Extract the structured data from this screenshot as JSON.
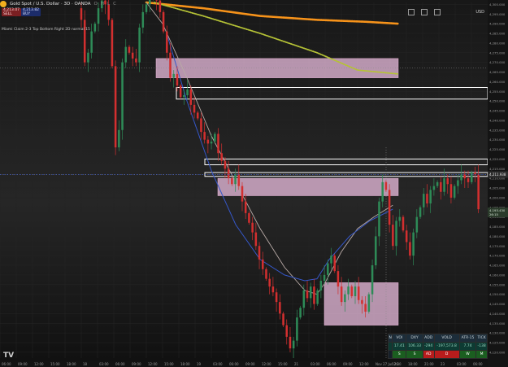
{
  "header": {
    "title": "Gold Spot / U.S. Dollar · 3D · OANDA",
    "ohlc": [
      "O",
      "H",
      "L",
      "C"
    ]
  },
  "quotes": {
    "sell": {
      "price": "4,213.07",
      "label": "SELL"
    },
    "buy": {
      "price": "4,213.82",
      "label": "BUY"
    }
  },
  "indicator_label": "Miami Claim 2-3 Top Bottom Right 2D normal 15",
  "currency": "USD",
  "colors": {
    "background": "#151515",
    "bull": "#2e8b57",
    "bear": "#d32f2f",
    "zone_pink": "#f3c4e6",
    "zone_white": "#ffffff",
    "ema_orange": "#f7931a",
    "ema_olive": "#b5c236",
    "ma_light": "#b8aaa6",
    "ma_blue": "#3557c8",
    "grid": "#242424"
  },
  "chart_data": {
    "type": "candlestick",
    "symbol": "Gold Spot / U.S. Dollar",
    "interval": "3D",
    "broker": "OANDA",
    "ylim": [
      4117,
      4301
    ],
    "ylabels": [
      "4,300.000",
      "4,295.000",
      "4,290.000",
      "4,285.000",
      "4,280.000",
      "4,275.000",
      "4,270.000",
      "4,265.000",
      "4,260.000",
      "4,255.000",
      "4,250.000",
      "4,245.000",
      "4,240.000",
      "4,235.000",
      "4,230.000",
      "4,225.000",
      "4,220.000",
      "4,215.000",
      "4,210.000",
      "4,205.000",
      "4,200.000",
      "4,195.000",
      "4,190.000",
      "4,185.000",
      "4,180.000",
      "4,175.000",
      "4,170.000",
      "4,165.000",
      "4,160.000",
      "4,155.000",
      "4,150.000",
      "4,145.000",
      "4,140.000",
      "4,135.000",
      "4,130.000",
      "4,125.000",
      "4,120.000"
    ],
    "yticks": [
      4300,
      4295,
      4290,
      4285,
      4280,
      4275,
      4270,
      4265,
      4260,
      4255,
      4250,
      4245,
      4240,
      4235,
      4230,
      4225,
      4220,
      4215,
      4210,
      4205,
      4200,
      4195,
      4190,
      4185,
      4180,
      4175,
      4170,
      4165,
      4160,
      4155,
      4150,
      4145,
      4140,
      4135,
      4130,
      4125,
      4120
    ],
    "current_price": "4,211.938",
    "current_price_value": 4211.94,
    "level_labels": [
      {
        "text": "4,193.430",
        "value": 4193.4
      },
      {
        "text": "26:15",
        "value": 4191.3
      }
    ],
    "xlabels": [
      "06:00",
      "09:00",
      "12:00",
      "15:00",
      "18:00",
      "18",
      "03:00",
      "06:00",
      "09:00",
      "12:00",
      "15:00",
      "18:00",
      "19",
      "03:00",
      "06:00",
      "09:00",
      "12:00",
      "15:00",
      "21",
      "03:00",
      "06:00",
      "09:00",
      "12:00",
      "Nov 27  Jun 26",
      "12:30",
      "18:00",
      "21:00",
      "23",
      "03:00",
      "06:00"
    ],
    "xpos": [
      0,
      14,
      28,
      42,
      56,
      70,
      84,
      98,
      112,
      126,
      140,
      154,
      168,
      182,
      196,
      210,
      224,
      238,
      252,
      266,
      280,
      294,
      308,
      322,
      336,
      350,
      364,
      378,
      392,
      406
    ],
    "x_range": [
      0,
      420
    ],
    "candle_x_range": [
      0,
      345
    ],
    "closes": [
      4298,
      4292,
      4270,
      4275,
      4286,
      4290,
      4298,
      4302,
      4300,
      4292,
      4268,
      4226,
      4235,
      4270,
      4278,
      4275,
      4272,
      4270,
      4288,
      4296,
      4300,
      4304,
      4304,
      4302,
      4296,
      4286,
      4275,
      4262,
      4264,
      4258,
      4252,
      4253,
      4256,
      4248,
      4244,
      4241,
      4234,
      4230,
      4228,
      4229,
      4233,
      4223,
      4219,
      4215,
      4210,
      4207,
      4212,
      4206,
      4198,
      4192,
      4187,
      4182,
      4175,
      4168,
      4163,
      4158,
      4154,
      4151,
      4146,
      4140,
      4134,
      4128,
      4122,
      4126,
      4138,
      4143,
      4152,
      4148,
      4154,
      4145,
      4152,
      4157,
      4160,
      4166,
      4170,
      4162,
      4154,
      4146,
      4150,
      4154,
      4149,
      4154,
      4147,
      4145,
      4141,
      4150,
      4165,
      4180,
      4198,
      4208,
      4204,
      4186,
      4175,
      4188,
      4190,
      4183,
      4177,
      4170,
      4182,
      4190,
      4195,
      4202,
      4197,
      4204,
      4206,
      4208,
      4203,
      4210,
      4207,
      4200,
      4206,
      4209,
      4212,
      4210,
      4208,
      4213,
      4212,
      4194
    ],
    "series": [
      {
        "name": "orange_ema",
        "values": [
          [
            180,
            4301
          ],
          [
            250,
            4298
          ],
          [
            320,
            4294
          ],
          [
            390,
            4292
          ],
          [
            450,
            4291
          ],
          [
            490,
            4290
          ]
        ]
      },
      {
        "name": "olive_ema",
        "values": [
          [
            190,
            4301
          ],
          [
            250,
            4294
          ],
          [
            320,
            4285
          ],
          [
            390,
            4275
          ],
          [
            440,
            4266
          ],
          [
            490,
            4264
          ]
        ]
      },
      {
        "name": "light_ma",
        "values": [
          [
            180,
            4301
          ],
          [
            200,
            4290
          ],
          [
            230,
            4262
          ],
          [
            260,
            4232
          ],
          [
            290,
            4208
          ],
          [
            320,
            4184
          ],
          [
            350,
            4164
          ],
          [
            375,
            4152
          ],
          [
            390,
            4150
          ],
          [
            400,
            4156
          ],
          [
            420,
            4172
          ],
          [
            440,
            4184
          ],
          [
            460,
            4190
          ],
          [
            483,
            4196
          ]
        ]
      },
      {
        "name": "blue_ma",
        "values": [
          [
            205,
            4285
          ],
          [
            230,
            4250
          ],
          [
            260,
            4214
          ],
          [
            290,
            4186
          ],
          [
            320,
            4168
          ],
          [
            350,
            4160
          ],
          [
            375,
            4157
          ],
          [
            390,
            4158
          ],
          [
            405,
            4168
          ],
          [
            430,
            4180
          ],
          [
            455,
            4188
          ],
          [
            483,
            4194
          ]
        ]
      }
    ],
    "zones": [
      {
        "color": "pink",
        "x": [
          192,
          490
        ],
        "y": [
          4262,
          4272
        ]
      },
      {
        "color": "white",
        "x": [
          217,
          600
        ],
        "y": [
          4251,
          4257
        ]
      },
      {
        "color": "white",
        "x": [
          252,
          600
        ],
        "y": [
          4217,
          4220
        ]
      },
      {
        "color": "white",
        "x": [
          252,
          600
        ],
        "y": [
          4211,
          4213
        ]
      },
      {
        "color": "pink",
        "x": [
          268,
          490
        ],
        "y": [
          4201,
          4210
        ]
      },
      {
        "color": "pink",
        "x": [
          399,
          490
        ],
        "y": [
          4134,
          4156
        ]
      }
    ],
    "horizontal_lines": [
      4267,
      4212
    ],
    "vertical_line_x": 475
  },
  "stats": {
    "headers": [
      "N",
      "VOI",
      "DXY",
      "ADD",
      "VOLD",
      "ATR·15",
      "TICK"
    ],
    "values": [
      "",
      "17.41",
      "106.33",
      "-294",
      "-197,573.8",
      "7.74",
      "-138"
    ],
    "signals": [
      "",
      "S",
      "S",
      "AD",
      "D",
      "W",
      "M"
    ],
    "signal_colors": [
      "#17202a",
      "#1b5e20",
      "#1b5e20",
      "#b71c1c",
      "#b71c1c",
      "#1b5e20",
      "#1b5e20"
    ]
  }
}
